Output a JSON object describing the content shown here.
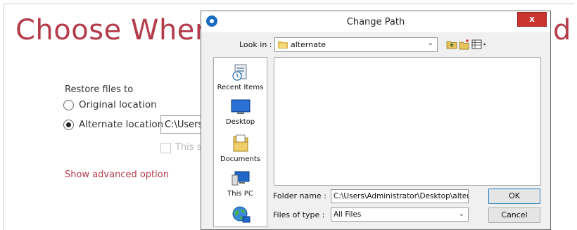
{
  "background": {
    "title_visible": "Choose Wher",
    "title_tail": "d",
    "restore_label": "Restore files to",
    "options": [
      {
        "label": "Original location",
        "selected": false
      },
      {
        "label": "Alternate location",
        "selected": true
      }
    ],
    "alternate_path": "C:\\Users",
    "disabled_checkbox_label": "This s",
    "advanced_link": "Show advanced option",
    "accent_color": "#b43b4a"
  },
  "dialog": {
    "title": "Change Path",
    "close_label": "x",
    "look_in_label": "Look in :",
    "look_in_value": "alternate",
    "places": [
      {
        "label": "Recent Items",
        "icon": "recent-items-icon"
      },
      {
        "label": "Desktop",
        "icon": "desktop-icon"
      },
      {
        "label": "Documents",
        "icon": "documents-icon"
      },
      {
        "label": "This PC",
        "icon": "this-pc-icon"
      },
      {
        "label": "",
        "icon": "network-icon"
      }
    ],
    "folder_name_label": "Folder name :",
    "folder_name_value": "C:\\Users\\Administrator\\Desktop\\alternate",
    "files_of_type_label": "Files of type :",
    "files_of_type_value": "All Files",
    "ok_label": "OK",
    "cancel_label": "Cancel"
  }
}
